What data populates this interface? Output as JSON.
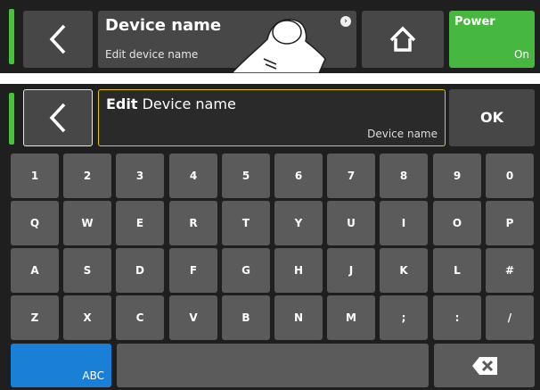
{
  "header": {
    "title": "Device name",
    "subtitle": "Edit device name",
    "info_icon": "info-icon",
    "power": {
      "label": "Power",
      "state": "On"
    }
  },
  "editor": {
    "title_bold": "Edit",
    "title_rest": " Device name",
    "current_value": "Device name",
    "ok_label": "OK"
  },
  "keyboard": {
    "rows": [
      [
        "1",
        "2",
        "3",
        "4",
        "5",
        "6",
        "7",
        "8",
        "9",
        "0"
      ],
      [
        "Q",
        "W",
        "E",
        "R",
        "T",
        "Y",
        "U",
        "I",
        "O",
        "P"
      ],
      [
        "A",
        "S",
        "D",
        "F",
        "G",
        "H",
        "J",
        "K",
        "L",
        "#"
      ],
      [
        "Z",
        "X",
        "C",
        "V",
        "B",
        "N",
        "M",
        ";",
        ":",
        "/"
      ]
    ],
    "mode_label": "ABC"
  },
  "colors": {
    "accent_green": "#45c43a",
    "power_green": "#47b83f",
    "edit_border": "#e3c81a",
    "abc_blue": "#1a7fd6"
  }
}
